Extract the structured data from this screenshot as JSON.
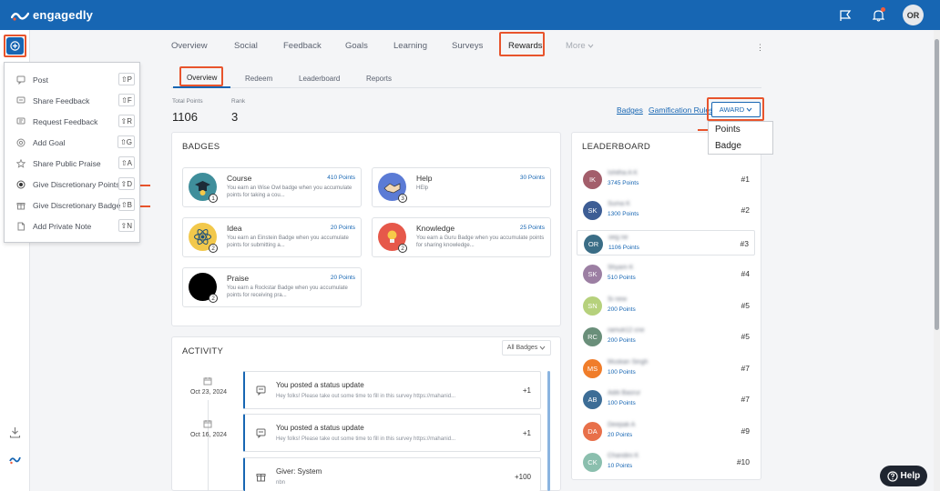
{
  "brand": {
    "name": "engagedly"
  },
  "user": {
    "initials": "OR"
  },
  "quick_menu": {
    "items": [
      {
        "label": "Post",
        "shortcut": "⇧P",
        "icon": "post-icon"
      },
      {
        "label": "Share Feedback",
        "shortcut": "⇧F",
        "icon": "feedback-icon"
      },
      {
        "label": "Request Feedback",
        "shortcut": "⇧R",
        "icon": "request-icon"
      },
      {
        "label": "Add Goal",
        "shortcut": "⇧G",
        "icon": "goal-icon"
      },
      {
        "label": "Share Public Praise",
        "shortcut": "⇧A",
        "icon": "star-icon"
      },
      {
        "label": "Give Discretionary Points",
        "shortcut": "⇧D",
        "icon": "points-icon"
      },
      {
        "label": "Give Discretionary Badge",
        "shortcut": "⇧B",
        "icon": "gift-icon"
      },
      {
        "label": "Add Private Note",
        "shortcut": "⇧N",
        "icon": "note-icon"
      }
    ]
  },
  "nav": {
    "tabs": [
      "Overview",
      "Social",
      "Feedback",
      "Goals",
      "Learning",
      "Surveys",
      "Rewards",
      "More"
    ],
    "active": "Rewards"
  },
  "subnav": {
    "tabs": [
      "Overview",
      "Redeem",
      "Leaderboard",
      "Reports"
    ],
    "active": "Overview"
  },
  "stats": {
    "total_points_label": "Total Points",
    "total_points": "1106",
    "rank_label": "Rank",
    "rank": "3"
  },
  "links": {
    "badges": "Badges",
    "gamification": "Gamification Rules"
  },
  "award": {
    "label": "AWARD",
    "options": [
      "Points",
      "Badge"
    ]
  },
  "badges": {
    "title": "BADGES",
    "items": [
      {
        "name": "Course",
        "points": "410 Points",
        "desc": "You earn an Wise Owl badge when you accumulate points for taking a cou...",
        "count": "1",
        "color": "#3f8e9b"
      },
      {
        "name": "Help",
        "points": "30 Points",
        "desc": "HElp",
        "count": "3",
        "color": "#5b7bd5"
      },
      {
        "name": "Idea",
        "points": "20 Points",
        "desc": "You earn an Einstein Badge when you accumulate points for submitting a...",
        "count": "2",
        "color": "#2b7bb5"
      },
      {
        "name": "Knowledge",
        "points": "25 Points",
        "desc": "You earn a Guru Badge when you accumulate points for sharing knowledge...",
        "count": "2",
        "color": "#e6584a"
      },
      {
        "name": "Praise",
        "points": "20 Points",
        "desc": "You earn a Rockstar Badge when you accumulate points for receiving pra...",
        "count": "2",
        "color": "#000000"
      }
    ]
  },
  "leaderboard": {
    "title": "LEADERBOARD",
    "rows": [
      {
        "initials": "IK",
        "name": "Ishitha A K",
        "points": "3745 Points",
        "rank": "#1",
        "color": "#a35e6b"
      },
      {
        "initials": "SK",
        "name": "Suma K",
        "points": "1300 Points",
        "rank": "#2",
        "color": "#3d5d94"
      },
      {
        "initials": "OR",
        "name": "oeg ne",
        "points": "1106 Points",
        "rank": "#3",
        "color": "#3a6d86"
      },
      {
        "initials": "SK",
        "name": "Shyam K",
        "points": "510 Points",
        "rank": "#4",
        "color": "#9c7fa3"
      },
      {
        "initials": "SN",
        "name": "Si new",
        "points": "200 Points",
        "rank": "#5",
        "color": "#b6d17c"
      },
      {
        "initials": "RC",
        "name": "ramuk12 cne",
        "points": "200 Points",
        "rank": "#5",
        "color": "#6a8f7a"
      },
      {
        "initials": "MS",
        "name": "Muskan Singh",
        "points": "100 Points",
        "rank": "#7",
        "color": "#f07d2a"
      },
      {
        "initials": "AB",
        "name": "Aditi Basrur",
        "points": "100 Points",
        "rank": "#7",
        "color": "#3d6d96"
      },
      {
        "initials": "DA",
        "name": "Deepak A",
        "points": "20 Points",
        "rank": "#9",
        "color": "#e8704a"
      },
      {
        "initials": "CK",
        "name": "Chandini K",
        "points": "10 Points",
        "rank": "#10",
        "color": "#8bbfae"
      }
    ]
  },
  "activity": {
    "title": "ACTIVITY",
    "filter": "All Badges",
    "items": [
      {
        "date": "Oct 23, 2024",
        "title": "You posted a status update",
        "sub": "Hey folks! Please take out some time to fill in this survey https://mahanid...",
        "delta": "+1"
      },
      {
        "date": "Oct 16, 2024",
        "title": "You posted a status update",
        "sub": "Hey folks! Please take out some time to fill in this survey https://mahanid...",
        "delta": "+1"
      },
      {
        "date": "",
        "title": "Giver: System",
        "sub": "nbn",
        "delta": "+100"
      }
    ]
  },
  "help": {
    "label": "Help"
  }
}
